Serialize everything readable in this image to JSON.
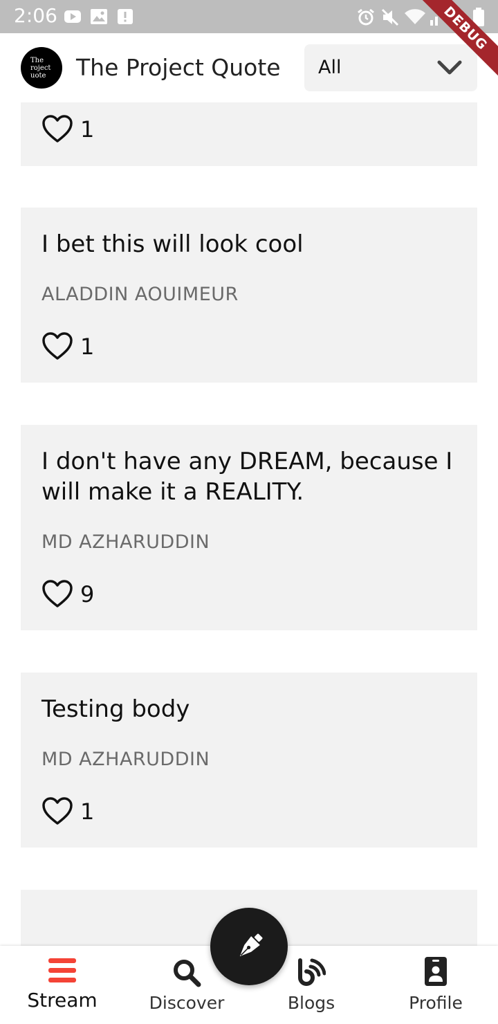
{
  "status_bar": {
    "time": "2:06",
    "debug_label": "DEBUG"
  },
  "app_bar": {
    "logo_lines": [
      "The",
      "roject",
      "uote"
    ],
    "title": "The Project Quote",
    "filter": {
      "selected": "All"
    }
  },
  "feed": {
    "cards": [
      {
        "quote": "",
        "author": "",
        "likes": "1"
      },
      {
        "quote": "I bet this will look cool",
        "author": "ALADDIN AOUIMEUR",
        "likes": "1"
      },
      {
        "quote": "I don't have any DREAM, because I will make it a REALITY.",
        "author": "MD AZHARUDDIN",
        "likes": "9"
      },
      {
        "quote": "Testing body",
        "author": "MD AZHARUDDIN",
        "likes": "1"
      }
    ]
  },
  "bottom_nav": {
    "items": [
      {
        "label": "Stream",
        "icon": "stream-icon",
        "active": true
      },
      {
        "label": "Discover",
        "icon": "search-icon"
      },
      {
        "label": "Blogs",
        "icon": "blog-icon"
      },
      {
        "label": "Profile",
        "icon": "profile-badge-icon"
      }
    ],
    "fab_icon": "pen-icon"
  },
  "colors": {
    "accent": "#f44336",
    "card_bg": "#f2f2f2",
    "status_bar": "#bdbdbd",
    "debug_ribbon": "#a4262c"
  }
}
